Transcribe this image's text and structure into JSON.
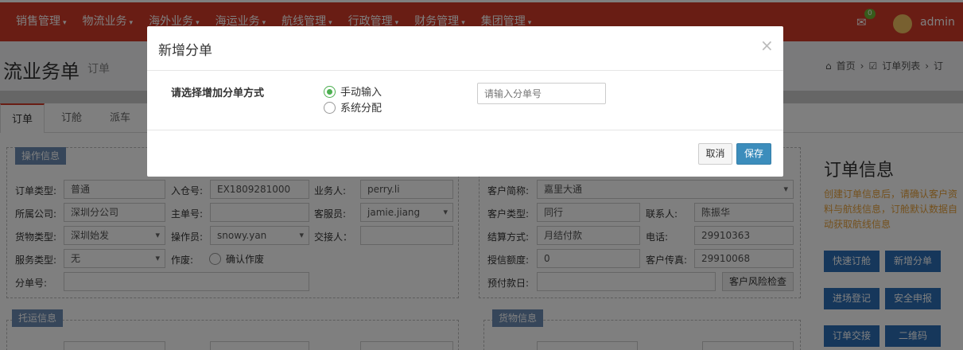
{
  "topnav": {
    "menus": [
      "销售管理",
      "物流业务",
      "海外业务",
      "海运业务",
      "航线管理",
      "行政管理",
      "财务管理",
      "集团管理"
    ],
    "mail_badge": "0",
    "username": "admin"
  },
  "header": {
    "title": "流业务单",
    "subtitle": "订单",
    "breadcrumb": [
      "首页",
      "订单列表",
      "订"
    ]
  },
  "tabs": [
    "订单",
    "订舱",
    "派车"
  ],
  "operation_info": {
    "legend": "操作信息",
    "order_type_label": "订单类型:",
    "order_type": "普通",
    "warehouse_no_label": "入仓号:",
    "warehouse_no": "EX1809281000",
    "salesman_label": "业务人:",
    "salesman": "perry.li",
    "company_label": "所属公司:",
    "company": "深圳分公司",
    "master_no_label": "主单号:",
    "master_no": "",
    "cs_label": "客服员:",
    "cs": "jamie.jiang",
    "cargo_type_label": "货物类型:",
    "cargo_type": "深圳始发",
    "operator_label": "操作员:",
    "operator": "snowy.yan",
    "handover_label": "交接人：",
    "handover": "",
    "service_type_label": "服务类型:",
    "service_type": "无",
    "job_label": "作废:",
    "job_option": "确认作废",
    "sub_no_label": "分单号:",
    "sub_no": ""
  },
  "customer_info": {
    "short_name_label": "客户简称:",
    "short_name": "嘉里大通",
    "type_label": "客户类型:",
    "type": "同行",
    "contact_label": "联系人:",
    "contact": "陈振华",
    "settle_label": "结算方式:",
    "settle": "月结付款",
    "phone_label": "电话:",
    "phone": "29910363",
    "credit_label": "授信额度:",
    "credit": "0",
    "fax_label": "客户传真:",
    "fax": "29910068",
    "prepay_label": "预付款日:",
    "prepay": "",
    "risk_button": "客户风险检查"
  },
  "shipping_info": {
    "legend": "托运信息"
  },
  "cargo_info": {
    "legend": "货物信息"
  },
  "side": {
    "title": "订单信息",
    "description": "创建订单信息后，请确认客户资料与航线信息，订舱默认数据自动获取航线信息",
    "buttons": [
      "快速订舱",
      "新增分单",
      "进场登记",
      "安全申报",
      "订单交接",
      "二维码"
    ]
  },
  "modal": {
    "title": "新增分单",
    "close": "×",
    "method_label": "请选择增加分单方式",
    "option_manual": "手动输入",
    "option_auto": "系统分配",
    "input_placeholder": "请输入分单号",
    "cancel": "取消",
    "save": "保存"
  }
}
